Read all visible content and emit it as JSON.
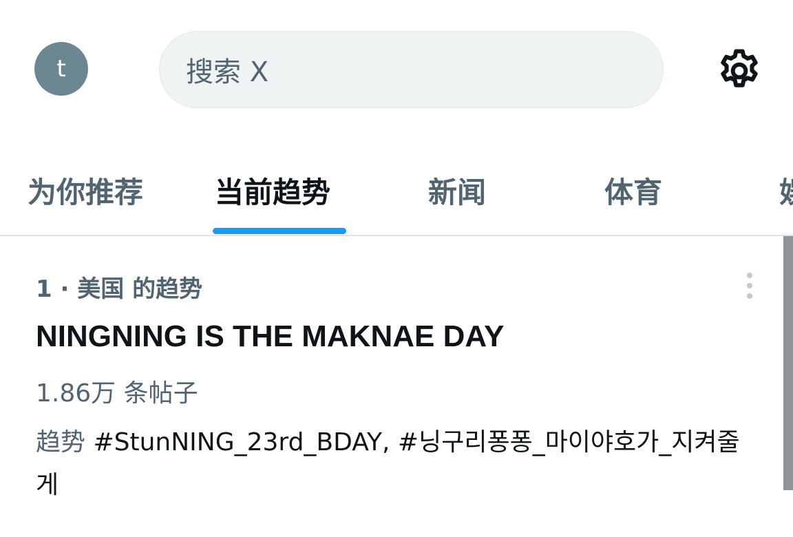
{
  "header": {
    "avatar_letter": "t",
    "search_placeholder": "搜索 X",
    "settings_icon": "gear-icon"
  },
  "tabs": [
    {
      "label": "为你推荐",
      "active": false
    },
    {
      "label": "当前趋势",
      "active": true
    },
    {
      "label": "新闻",
      "active": false
    },
    {
      "label": "体育",
      "active": false
    },
    {
      "label": "娱",
      "active": false
    }
  ],
  "colors": {
    "accent": "#1d9bf0",
    "avatar_bg": "#6d8792",
    "muted_text": "#536471",
    "primary_text": "#0f1419"
  },
  "trend": {
    "meta": "1 · 美国 的趋势",
    "title": "NINGNING IS THE MAKNAE DAY",
    "post_count": "1.86万 条帖子",
    "related_prefix": "趋势",
    "related_tags": "#StunNING_23rd_BDAY, #닝구리퐁퐁_마이야호가_지켜줄게",
    "more_icon": "more-vertical-icon"
  }
}
